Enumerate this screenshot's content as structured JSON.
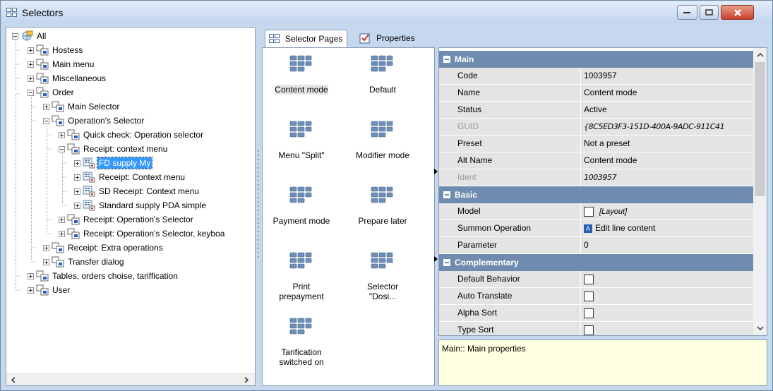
{
  "window": {
    "title": "Selectors"
  },
  "tree": {
    "items": [
      {
        "label": "All"
      },
      {
        "label": "Hostess"
      },
      {
        "label": "Main menu"
      },
      {
        "label": "Miscellaneous"
      },
      {
        "label": "Order"
      },
      {
        "label": "Main Selector"
      },
      {
        "label": "Operation's Selector"
      },
      {
        "label": "Quick check: Operation selector"
      },
      {
        "label": "Receipt: context menu"
      },
      {
        "label": "FD supply My"
      },
      {
        "label": "Receipt: Context menu"
      },
      {
        "label": "SD Receipt: Context menu"
      },
      {
        "label": "Standard supply PDA simple"
      },
      {
        "label": "Receipt: Operation's Selector"
      },
      {
        "label": "Receipt: Operation's Selector, keyboa"
      },
      {
        "label": "Receipt: Extra operations"
      },
      {
        "label": "Transfer dialog"
      },
      {
        "label": "Tables, orders choise, tariffication"
      },
      {
        "label": "User"
      }
    ]
  },
  "tabs": [
    {
      "label": "Selector Pages"
    },
    {
      "label": "Properties"
    }
  ],
  "pages": [
    {
      "line1": "Content mode",
      "line2": ""
    },
    {
      "line1": "Default",
      "line2": ""
    },
    {
      "line1": "Menu \"Split\"",
      "line2": ""
    },
    {
      "line1": "Modifier mode",
      "line2": ""
    },
    {
      "line1": "Payment mode",
      "line2": ""
    },
    {
      "line1": "Prepare later",
      "line2": ""
    },
    {
      "line1": "Print",
      "line2": "prepayment"
    },
    {
      "line1": "Selector",
      "line2": "\"Dosi..."
    },
    {
      "line1": "Tarification",
      "line2": "switched on"
    }
  ],
  "props": {
    "main": {
      "title": "Main",
      "rows": [
        {
          "key": "Code",
          "value": "1003957"
        },
        {
          "key": "Name",
          "value": "Content mode"
        },
        {
          "key": "Status",
          "value": "Active"
        },
        {
          "key": "GUID",
          "value": "{8C5ED3F3-151D-400A-9ADC-911C41"
        },
        {
          "key": "Preset",
          "value": "Not a preset"
        },
        {
          "key": "Alt Name",
          "value": "Content mode"
        },
        {
          "key": "Ident",
          "value": "1003957"
        }
      ]
    },
    "basic": {
      "title": "Basic",
      "rows": [
        {
          "key": "Model",
          "value": "[Layout]"
        },
        {
          "key": "Summon Operation",
          "value": "Edit line content",
          "badge": "A"
        },
        {
          "key": "Parameter",
          "value": "0"
        }
      ]
    },
    "complementary": {
      "title": "Complementary",
      "rows": [
        {
          "key": "Default Behavior"
        },
        {
          "key": "Auto Translate"
        },
        {
          "key": "Alpha Sort"
        },
        {
          "key": "Type Sort"
        }
      ]
    }
  },
  "description": "Main:: Main properties",
  "colors": {
    "accent": "#3399ff",
    "category": "#6f8cb0",
    "desc_bg": "#ffffe1"
  }
}
